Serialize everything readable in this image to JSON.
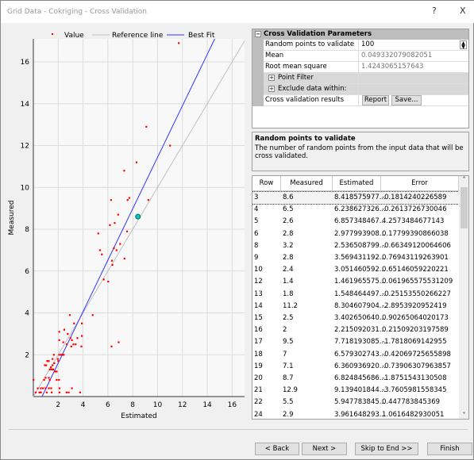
{
  "window": {
    "title": "Grid Data - Cokriging - Cross Validation",
    "help": "?",
    "close": "X"
  },
  "chart_data": {
    "type": "scatter",
    "xlabel": "Estimated",
    "ylabel": "Measured",
    "xlim": [
      0,
      17
    ],
    "ylim": [
      0,
      17.1
    ],
    "xticks": [
      "2",
      "4",
      "6",
      "8",
      "10",
      "12",
      "14",
      "16"
    ],
    "yticks": [
      "2",
      "4",
      "6",
      "8",
      "10",
      "12",
      "14",
      "16"
    ],
    "grid": true,
    "legend_position": "top",
    "legend": [
      {
        "label": "Value",
        "color": "#ff0000"
      },
      {
        "label": "Reference line",
        "color": "#c0c0c0"
      },
      {
        "label": "Best Fit",
        "color": "#3333ff"
      }
    ],
    "reference_line": {
      "slope": 1,
      "intercept": 0
    },
    "best_fit": {
      "slope": 1.23,
      "intercept": -0.86
    },
    "selected_point": {
      "x": 8.42,
      "y": 8.6,
      "color": "#00c8c8"
    },
    "points": [
      [
        11.7,
        16.9
      ],
      [
        9.09,
        12.9
      ],
      [
        11.0,
        12.0
      ],
      [
        8.3,
        11.2
      ],
      [
        7.31,
        10.8
      ],
      [
        6.25,
        9.4
      ],
      [
        7.58,
        9.4
      ],
      [
        7.72,
        9.5
      ],
      [
        9.25,
        9.4
      ],
      [
        6.82,
        8.7
      ],
      [
        6.54,
        8.3
      ],
      [
        6.16,
        8.2
      ],
      [
        7.54,
        7.9
      ],
      [
        5.22,
        7.8
      ],
      [
        6.98,
        7.3
      ],
      [
        6.48,
        7.1
      ],
      [
        6.69,
        7.0
      ],
      [
        5.36,
        7.0
      ],
      [
        5.51,
        6.8
      ],
      [
        7.33,
        6.6
      ],
      [
        6.32,
        6.5
      ],
      [
        6.36,
        6.3
      ],
      [
        5.66,
        5.6
      ],
      [
        6.02,
        5.5
      ],
      [
        2.93,
        3.9
      ],
      [
        4.77,
        3.9
      ],
      [
        3.27,
        3.5
      ],
      [
        3.9,
        3.5
      ],
      [
        2.48,
        3.2
      ],
      [
        2.08,
        3.1
      ],
      [
        2.76,
        3.0
      ],
      [
        3.9,
        2.9
      ],
      [
        3.54,
        2.8
      ],
      [
        2.98,
        2.8
      ],
      [
        2.08,
        2.7
      ],
      [
        3.1,
        2.7
      ],
      [
        2.4,
        2.6
      ],
      [
        2.69,
        2.5
      ],
      [
        3.22,
        2.5
      ],
      [
        3.4,
        2.5
      ],
      [
        6.29,
        2.4
      ],
      [
        6.86,
        2.6
      ],
      [
        3.86,
        2.4
      ],
      [
        3.05,
        2.4
      ],
      [
        2.08,
        2.0
      ],
      [
        2.44,
        2.0
      ],
      [
        1.64,
        2.0
      ],
      [
        2.23,
        2.0
      ],
      [
        2.36,
        2.0
      ],
      [
        1.54,
        1.8
      ],
      [
        1.96,
        1.8
      ],
      [
        2.0,
        1.7
      ],
      [
        1.11,
        1.7
      ],
      [
        1.24,
        1.7
      ],
      [
        1.68,
        1.6
      ],
      [
        0.92,
        1.5
      ],
      [
        1.03,
        1.5
      ],
      [
        1.54,
        1.5
      ],
      [
        1.41,
        1.4
      ],
      [
        1.32,
        1.3
      ],
      [
        1.47,
        1.3
      ],
      [
        1.6,
        1.3
      ],
      [
        1.74,
        1.2
      ],
      [
        1.87,
        1.2
      ],
      [
        1.24,
        0.9
      ],
      [
        1.32,
        0.8
      ],
      [
        0.86,
        0.8
      ],
      [
        0.98,
        0.9
      ],
      [
        1.87,
        0.8
      ],
      [
        2.06,
        0.8
      ],
      [
        0.01,
        0.8
      ],
      [
        0.35,
        0.4
      ],
      [
        0.6,
        0.4
      ],
      [
        0.77,
        0.4
      ],
      [
        0.98,
        0.4
      ],
      [
        1.24,
        0.4
      ],
      [
        1.43,
        0.4
      ],
      [
        2.1,
        0.4
      ],
      [
        3.1,
        0.4
      ],
      [
        0.18,
        0.2
      ],
      [
        0.48,
        0.2
      ],
      [
        0.6,
        0.2
      ],
      [
        1.07,
        0.2
      ],
      [
        1.47,
        0.2
      ],
      [
        2.1,
        0.2
      ],
      [
        2.67,
        0.2
      ],
      [
        2.84,
        0.2
      ],
      [
        3.76,
        0.2
      ]
    ]
  },
  "params": {
    "header": "Cross Validation Parameters",
    "rows": [
      {
        "label": "Random points to validate",
        "value": "100"
      },
      {
        "label": "Mean",
        "value": "0.049332079082051"
      },
      {
        "label": "Root mean square",
        "value": "1.4243065157643"
      }
    ],
    "point_filter": "Point Filter",
    "exclude": "Exclude data within:",
    "results_label": "Cross validation results",
    "report": "Report",
    "save": "Save..."
  },
  "help": {
    "title": "Random points to validate",
    "text": "The number of random points from the input data that will be cross validated."
  },
  "table": {
    "columns": [
      "Row",
      "Measured",
      "Estimated",
      "Error"
    ],
    "rows": [
      [
        "3",
        "8.6",
        "8.418575977...",
        "-0.1814240226589"
      ],
      [
        "4",
        "6.5",
        "6.238627326...",
        "-0.2613726730046"
      ],
      [
        "5",
        "2.6",
        "6.857348467...",
        "4.2573484677143"
      ],
      [
        "6",
        "2.8",
        "2.977993908...",
        "0.17799390866038"
      ],
      [
        "8",
        "3.2",
        "2.536508799...",
        "-0.66349120064606"
      ],
      [
        "9",
        "2.8",
        "3.569431192...",
        "0.76943119263901"
      ],
      [
        "10",
        "2.4",
        "3.051460592...",
        "0.65146059220221"
      ],
      [
        "12",
        "1.4",
        "1.461965575...",
        "0.061965575531209"
      ],
      [
        "13",
        "1.8",
        "1.548464497...",
        "-0.25153550266227"
      ],
      [
        "14",
        "11.2",
        "8.304607904...",
        "-2.8953920952419"
      ],
      [
        "15",
        "2.5",
        "3.402650640...",
        "0.90265064020173"
      ],
      [
        "16",
        "2",
        "2.215092031...",
        "0.21509203197589"
      ],
      [
        "17",
        "9.5",
        "7.718193085...",
        "-1.7818069142955"
      ],
      [
        "18",
        "7",
        "6.579302743...",
        "-0.42069725655898"
      ],
      [
        "19",
        "7.1",
        "6.360936920...",
        "-0.73906307963857"
      ],
      [
        "20",
        "8.7",
        "6.824845686...",
        "-1.8751543130508"
      ],
      [
        "21",
        "12.9",
        "9.139401844...",
        "-3.7605981558345"
      ],
      [
        "22",
        "5.5",
        "5.947783845...",
        "0.447783845369"
      ],
      [
        "24",
        "2.9",
        "3.961648293...",
        "1.0616482930051"
      ]
    ]
  },
  "footer": {
    "back": "< Back",
    "next": "Next >",
    "skip": "Skip to End >>",
    "finish": "Finish"
  }
}
